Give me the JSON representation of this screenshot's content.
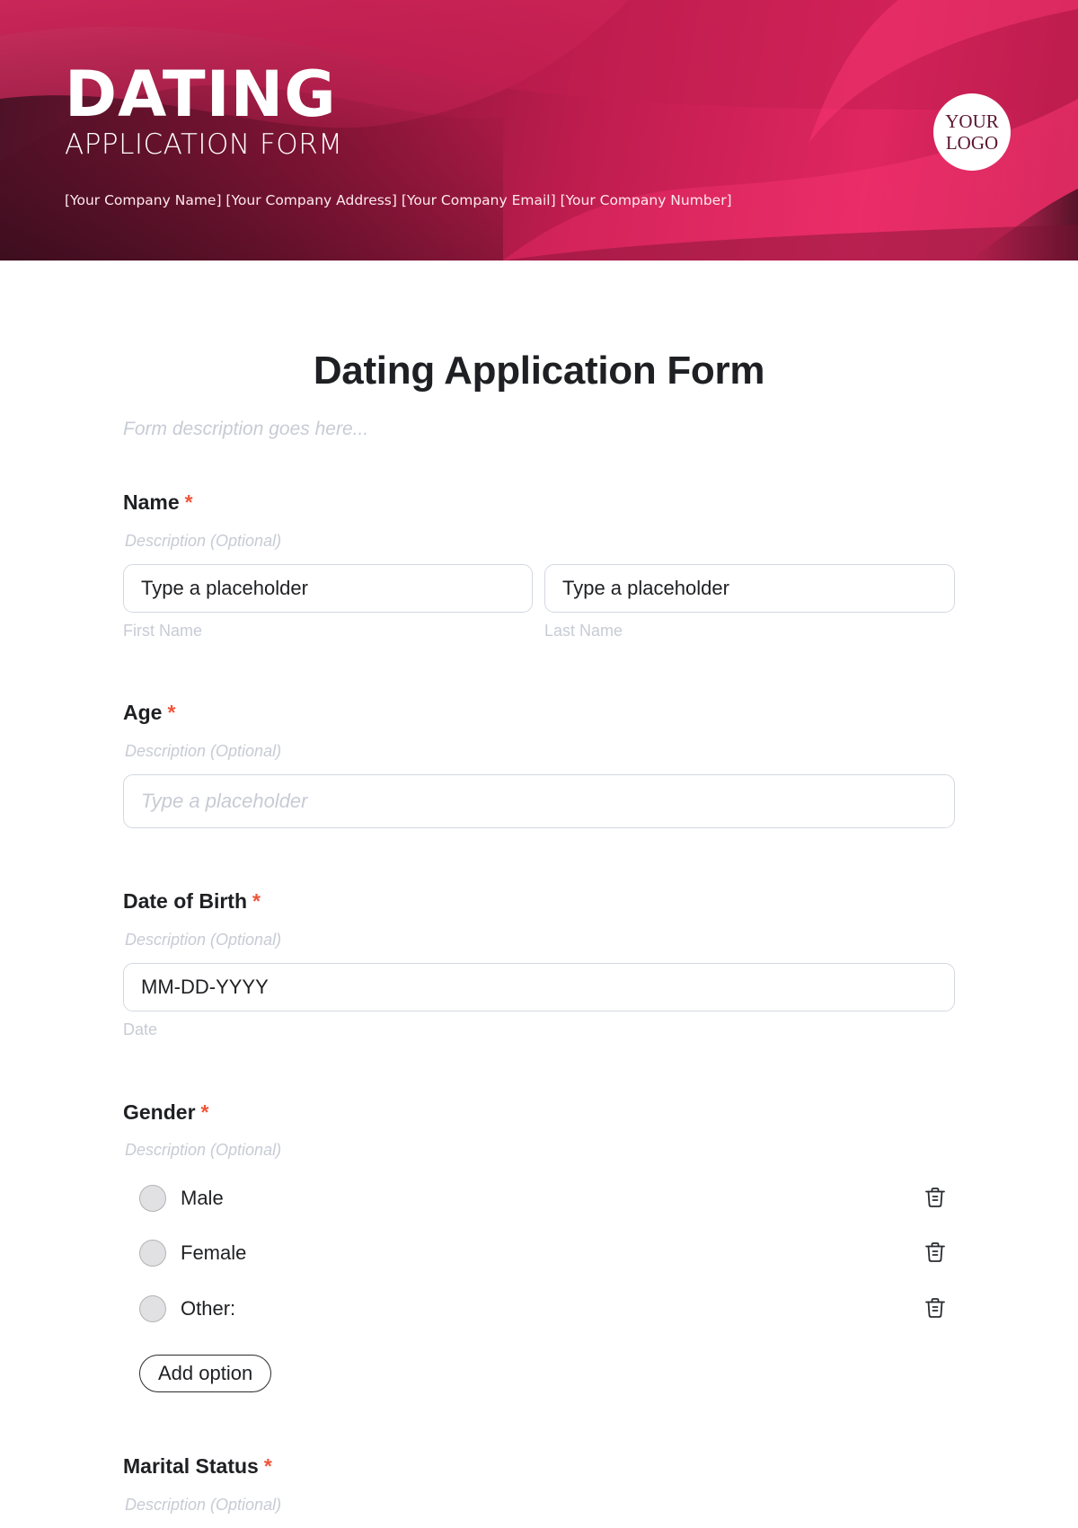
{
  "header": {
    "brand_title": "DATING",
    "brand_subtitle": "APPLICATION FORM",
    "company_line": "[Your Company Name] [Your Company Address] [Your Company Email] [Your Company Number]",
    "logo_line1": "YOUR",
    "logo_line2": "LOGO",
    "colors": {
      "gradient_dark": "#4a1226",
      "gradient_mid": "#c01d4f",
      "gradient_light": "#ff3773"
    }
  },
  "form": {
    "title": "Dating Application Form",
    "description_placeholder": "Form description goes here...",
    "required_marker": "*",
    "required_color": "#f0553a",
    "questions": [
      {
        "label": "Name",
        "required": true,
        "description_placeholder": "Description (Optional)",
        "fields": [
          {
            "value": "Type a placeholder",
            "sublabel": "First Name"
          },
          {
            "value": "Type a placeholder",
            "sublabel": "Last Name"
          }
        ]
      },
      {
        "label": "Age",
        "required": true,
        "description_placeholder": "Description (Optional)",
        "fields": [
          {
            "placeholder": "Type a placeholder"
          }
        ]
      },
      {
        "label": "Date of Birth",
        "required": true,
        "description_placeholder": "Description (Optional)",
        "fields": [
          {
            "value": "MM-DD-YYYY",
            "sublabel": "Date"
          }
        ]
      },
      {
        "label": "Gender",
        "required": true,
        "description_placeholder": "Description (Optional)",
        "options": [
          {
            "label": "Male",
            "selected": false,
            "icon": "trash-icon"
          },
          {
            "label": "Female",
            "selected": false,
            "icon": "trash-icon"
          },
          {
            "label": "Other:",
            "selected": false,
            "icon": "trash-icon"
          }
        ],
        "add_option_label": "Add option"
      },
      {
        "label": "Marital Status",
        "required": true,
        "description_placeholder": "Description (Optional)"
      }
    ]
  }
}
